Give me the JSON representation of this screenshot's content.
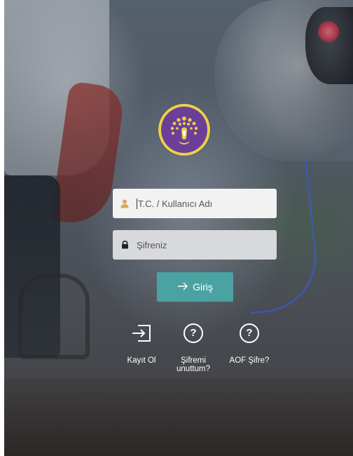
{
  "login_form": {
    "username_placeholder": "T.C. / Kullanıcı Adı",
    "password_placeholder": "Şifreniz",
    "submit_label": "Giriş"
  },
  "actions": {
    "register_label": "Kayıt Ol",
    "forgot_line1": "Şifremi",
    "forgot_line2": "unuttum?",
    "aof_label": "AOF Şifre?",
    "question_glyph": "?"
  },
  "icons": {
    "username": "user-icon",
    "password": "lock-icon",
    "submit": "arrow-right-icon",
    "register": "sign-in-box-icon",
    "forgot": "question-circle-icon",
    "aof": "question-circle-icon"
  },
  "colors": {
    "logo_ring": "#e9cf4b",
    "logo_fill": "#6b3f98",
    "submit_button": "#4aa3a2",
    "user_icon": "#d9a85a"
  }
}
